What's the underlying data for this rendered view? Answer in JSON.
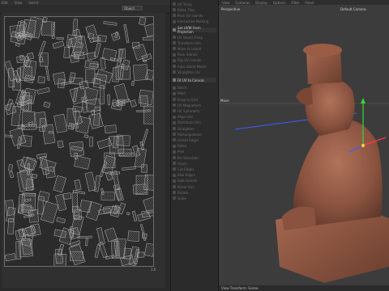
{
  "uv_editor": {
    "menu": [
      "Edit",
      "View",
      "Select"
    ],
    "dropdown_value": "Object",
    "grid_label": "1.0"
  },
  "tools": {
    "items": [
      {
        "label": "UV Tiling",
        "header": false
      },
      {
        "label": "Relax Tiles",
        "header": false
      },
      {
        "label": "Pack UV Islands",
        "header": false
      },
      {
        "label": "Interactive Packing",
        "header": false
      },
      {
        "label": "Set UVW From Projection",
        "header": true
      },
      {
        "label": "UV Island Tiling",
        "header": false
      },
      {
        "label": "Transform UVs",
        "header": false
      },
      {
        "label": "Move to Island",
        "header": false
      },
      {
        "label": "Pack Islands",
        "header": false
      },
      {
        "label": "Flip UV Islands",
        "header": false
      },
      {
        "label": "Auto Island Maker",
        "header": false
      },
      {
        "label": "Straighten UV",
        "header": false
      },
      {
        "label": "Fit UV to Canvas",
        "header": true
      },
      {
        "label": "Stitch",
        "header": false
      },
      {
        "label": "Weld",
        "header": false
      },
      {
        "label": "Snap to Grid",
        "header": false
      },
      {
        "label": "UV Magnetism",
        "header": false
      },
      {
        "label": "UV Symmetry",
        "header": false
      },
      {
        "label": "Align UVs",
        "header": false
      },
      {
        "label": "Distribute UVs",
        "header": false
      },
      {
        "label": "Straighten",
        "header": false
      },
      {
        "label": "Rectangularize",
        "header": false
      },
      {
        "label": "Unfold Edges",
        "header": false
      },
      {
        "label": "Relax",
        "header": false
      },
      {
        "label": "Peel",
        "header": false
      },
      {
        "label": "Pin Selection",
        "header": false
      },
      {
        "label": "Unpin",
        "header": false
      },
      {
        "label": "Cut Edges",
        "header": false
      },
      {
        "label": "Sew Edges",
        "header": false
      },
      {
        "label": "Split Islands",
        "header": false
      },
      {
        "label": "Mirror UVs",
        "header": false
      },
      {
        "label": "Rotate",
        "header": false
      },
      {
        "label": "Scale",
        "header": false
      }
    ]
  },
  "viewport": {
    "menu": [
      "View",
      "Cameras",
      "Display",
      "Options",
      "Filter",
      "Panel"
    ],
    "label": "Perspective",
    "camera": "Default Camera",
    "move_label": "Move",
    "bottom_text": "View Transform: Scene"
  }
}
